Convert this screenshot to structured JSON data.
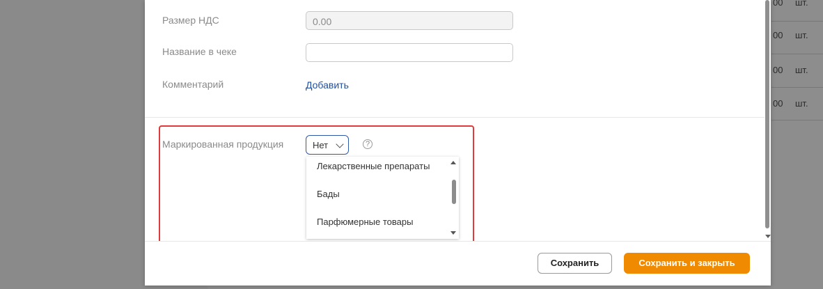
{
  "background_table": {
    "rows": [
      {
        "qty": "00",
        "unit": "шт."
      },
      {
        "qty": "00",
        "unit": "шт."
      },
      {
        "qty": "00",
        "unit": "шт."
      },
      {
        "qty": "00",
        "unit": "шт."
      }
    ]
  },
  "form": {
    "vat_size": {
      "label": "Размер НДС",
      "value": "0.00"
    },
    "receipt_name": {
      "label": "Название в чеке",
      "value": ""
    },
    "comment": {
      "label": "Комментарий",
      "link": "Добавить"
    },
    "marked_products": {
      "label": "Маркированная продукция",
      "selected": "Нет",
      "help_icon": "question-circle-icon",
      "options": [
        "Лекарственные препараты",
        "Бады",
        "Парфюмерные товары"
      ]
    }
  },
  "footer": {
    "save_label": "Сохранить",
    "save_close_label": "Сохранить и закрыть"
  },
  "colors": {
    "accent": "#f08a00",
    "link": "#1f4fa0",
    "highlight": "#e03a3a"
  }
}
